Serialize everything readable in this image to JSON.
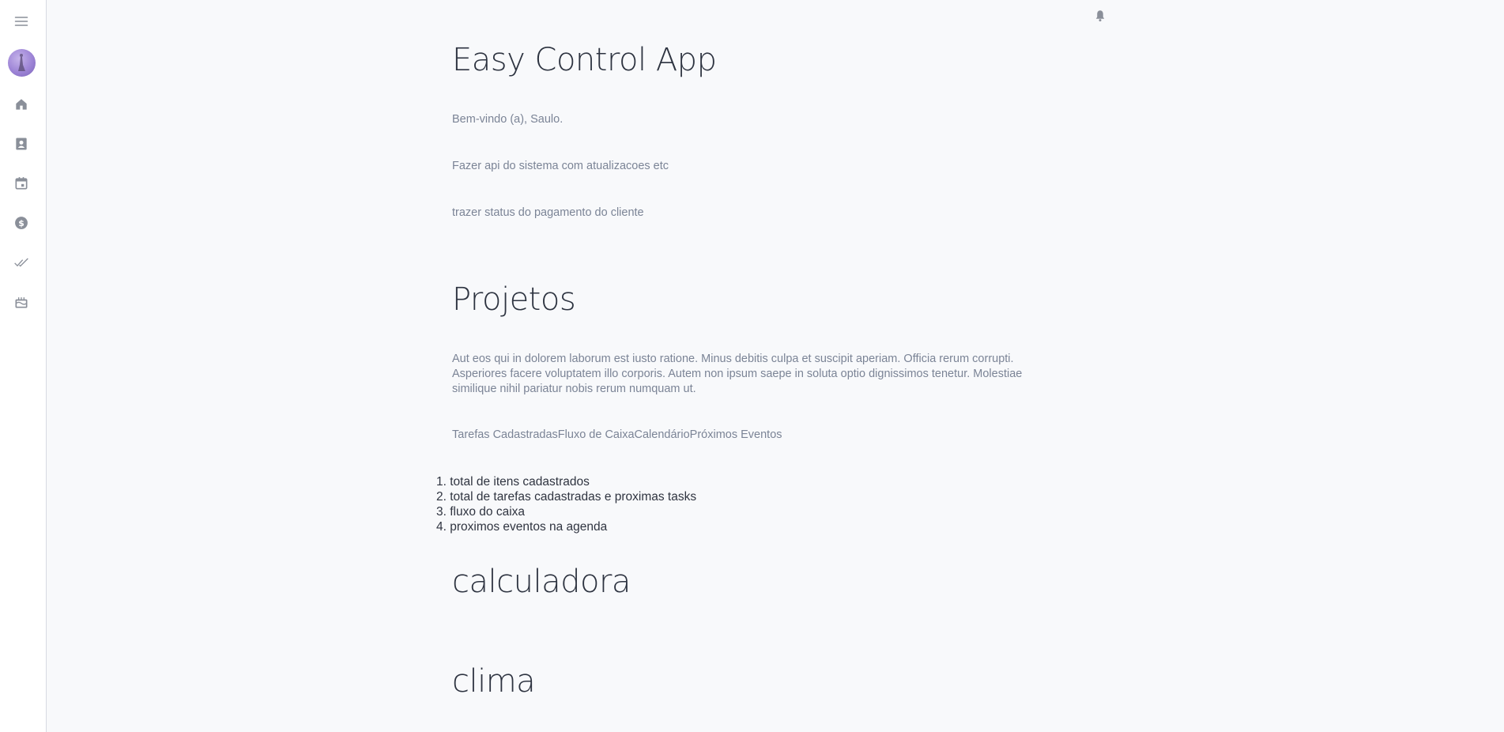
{
  "sidebar": {
    "items": [
      {
        "name": "menu",
        "icon": "menu-icon"
      },
      {
        "name": "profile",
        "icon": "avatar"
      },
      {
        "name": "home",
        "icon": "home-icon"
      },
      {
        "name": "contacts",
        "icon": "contact-card-icon"
      },
      {
        "name": "calendar",
        "icon": "calendar-icon"
      },
      {
        "name": "finance",
        "icon": "dollar-coin-icon"
      },
      {
        "name": "tasks",
        "icon": "double-check-icon"
      },
      {
        "name": "events",
        "icon": "cake-icon"
      }
    ]
  },
  "header": {
    "notification_icon": "bell-icon"
  },
  "main": {
    "title": "Easy Control App",
    "welcome": "Bem-vindo (a), Saulo.",
    "note1": "Fazer api do sistema com atualizacoes etc",
    "note2": "trazer status do pagamento do cliente",
    "projects_heading": "Projetos",
    "projects_text": "Aut eos qui in dolorem laborum est iusto ratione. Minus debitis culpa et suscipit aperiam. Officia rerum corrupti. Asperiores facere voluptatem illo corporis. Autem non ipsum saepe in soluta optio dignissimos tenetur. Molestiae similique nihil pariatur nobis rerum numquam ut.",
    "tabs": [
      "Tarefas Cadastradas",
      "Fluxo de Caixa",
      "Calendário",
      "Próximos Eventos"
    ],
    "list": [
      "total de itens cadastrados",
      "total de tarefas cadastradas e proximas tasks",
      "fluxo do caixa",
      "proximos eventos na agenda"
    ],
    "calculator_heading": "calculadora",
    "weather_heading": "clima"
  },
  "colors": {
    "background": "#f8f9fb",
    "sidebar": "#ffffff",
    "icon": "#8a8f99",
    "heading": "#2d3340",
    "muted_text": "#7b8496"
  }
}
